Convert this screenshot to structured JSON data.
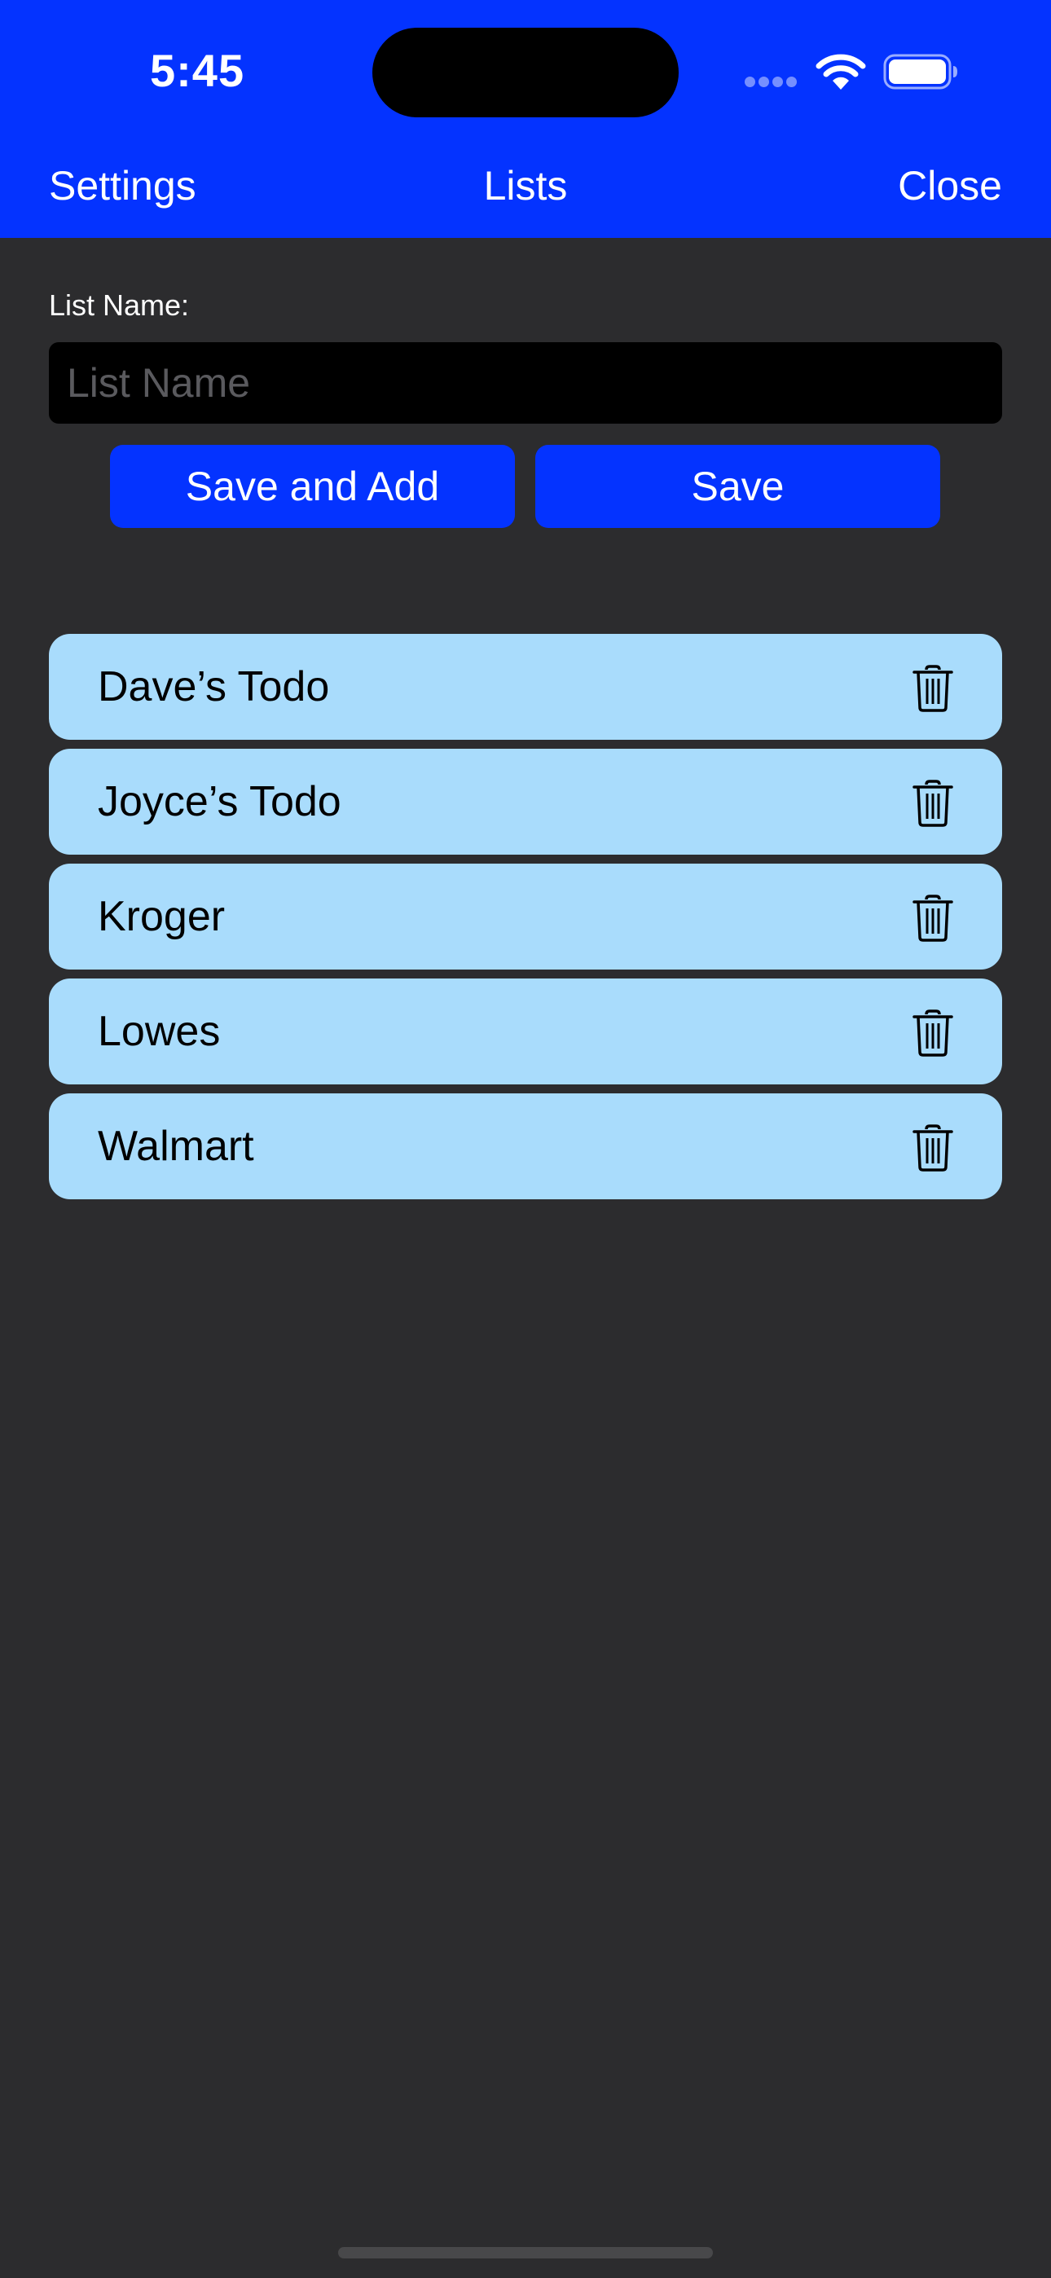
{
  "status_bar": {
    "time": "5:45"
  },
  "nav": {
    "left_label": "Settings",
    "title": "Lists",
    "right_label": "Close"
  },
  "form": {
    "label": "List Name:",
    "input_value": "",
    "input_placeholder": "List Name",
    "save_and_add_label": "Save and Add",
    "save_label": "Save"
  },
  "lists": [
    {
      "name": "Dave’s Todo",
      "action_icon": "trash-icon"
    },
    {
      "name": "Joyce’s Todo",
      "action_icon": "trash-icon"
    },
    {
      "name": "Kroger",
      "action_icon": "trash-icon"
    },
    {
      "name": "Lowes",
      "action_icon": "trash-icon"
    },
    {
      "name": "Walmart",
      "action_icon": "trash-icon"
    }
  ],
  "colors": {
    "accent": "#0433ff",
    "background": "#2c2c2e",
    "list_item": "#a9dcfc",
    "input_background": "#000000"
  }
}
